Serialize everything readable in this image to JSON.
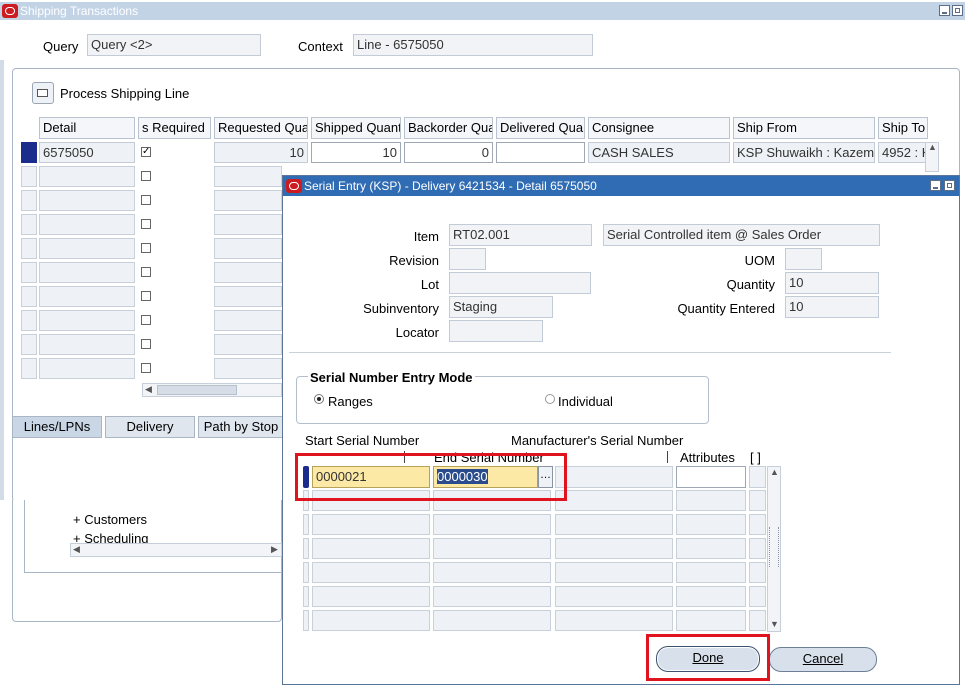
{
  "main_window": {
    "title": "Shipping Transactions",
    "query_label": "Query",
    "query_value": "Query <2>",
    "context_label": "Context",
    "context_value": "Line - 6575050",
    "process_line_label": "Process Shipping Line",
    "columns": [
      "Detail",
      "s Required",
      "Requested Qua",
      "Shipped Quant",
      "Backorder Qua",
      "Delivered Quar",
      "Consignee",
      "Ship From",
      "Ship To"
    ],
    "row1": {
      "detail": "6575050",
      "required_checked": true,
      "requested": "10",
      "shipped": "10",
      "backorder": "0",
      "delivered": "",
      "consignee": "CASH SALES",
      "ship_from": "KSP Shuwaikh : Kazem",
      "ship_to": "4952 : K"
    },
    "tabs": [
      "Lines/LPNs",
      "Delivery",
      "Path by Stop"
    ],
    "tree_items": [
      "+  Customers",
      "+  Scheduling"
    ]
  },
  "serial_dialog": {
    "title": "Serial Entry (KSP) - Delivery 6421534 - Detail 6575050",
    "item_label": "Item",
    "item_value": "RT02.001",
    "item_description": "Serial Controlled item @ Sales Order",
    "revision_label": "Revision",
    "revision_value": "",
    "uom_label": "UOM",
    "uom_value": "",
    "lot_label": "Lot",
    "lot_value": "",
    "quantity_label": "Quantity",
    "quantity_value": "10",
    "subinventory_label": "Subinventory",
    "subinventory_value": "Staging",
    "quantity_entered_label": "Quantity Entered",
    "quantity_entered_value": "10",
    "locator_label": "Locator",
    "locator_value": "",
    "mode_group_label": "Serial Number Entry Mode",
    "mode_ranges": "Ranges",
    "mode_individual": "Individual",
    "mode_selected": "Ranges",
    "col_start": "Start Serial Number",
    "col_end": "End Serial Number",
    "col_manufacturer": "Manufacturer's Serial Number",
    "col_attributes": "Attributes",
    "col_dff": "[ ]",
    "row1_start": "0000021",
    "row1_end": "0000030",
    "done_label": "Done",
    "cancel_label": "Cancel"
  },
  "colors": {
    "titlebar_active": "#2f6cb4",
    "titlebar_inactive": "#b4c6dc",
    "highlight_red": "#e0141e",
    "current_field_yellow": "#fde9a6"
  }
}
